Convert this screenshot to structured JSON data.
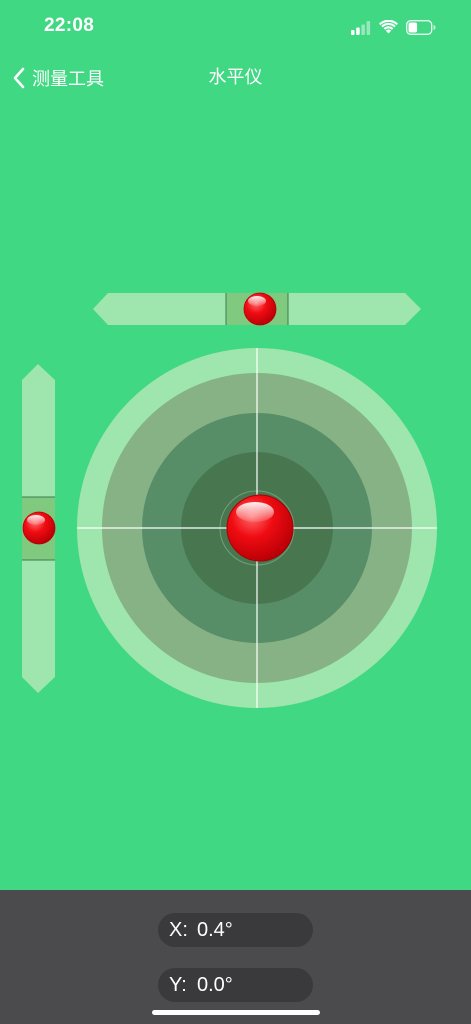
{
  "status_bar": {
    "time": "22:08",
    "icons": [
      "cellular-signal-icon",
      "wifi-icon",
      "battery-icon"
    ],
    "battery_level": 0.4
  },
  "nav": {
    "back_label": "测量工具",
    "title": "水平仪"
  },
  "level": {
    "x_tilt_deg": 0.4,
    "y_tilt_deg": 0.0,
    "colors": {
      "background": "#40d882",
      "tube": "#9ee6ae",
      "tube_center": "#7fca7e",
      "ring_outer": "#9ee6ae",
      "ring_2": "#87b286",
      "ring_3": "#578e68",
      "ring_4": "#48774f",
      "bubble": "#ee0a0f",
      "crosshair": "#ffffff"
    }
  },
  "readouts": {
    "x_axis": "X:",
    "x_value": "0.4°",
    "y_axis": "Y:",
    "y_value": "0.0°"
  },
  "panel_color": "#4b4b4d"
}
